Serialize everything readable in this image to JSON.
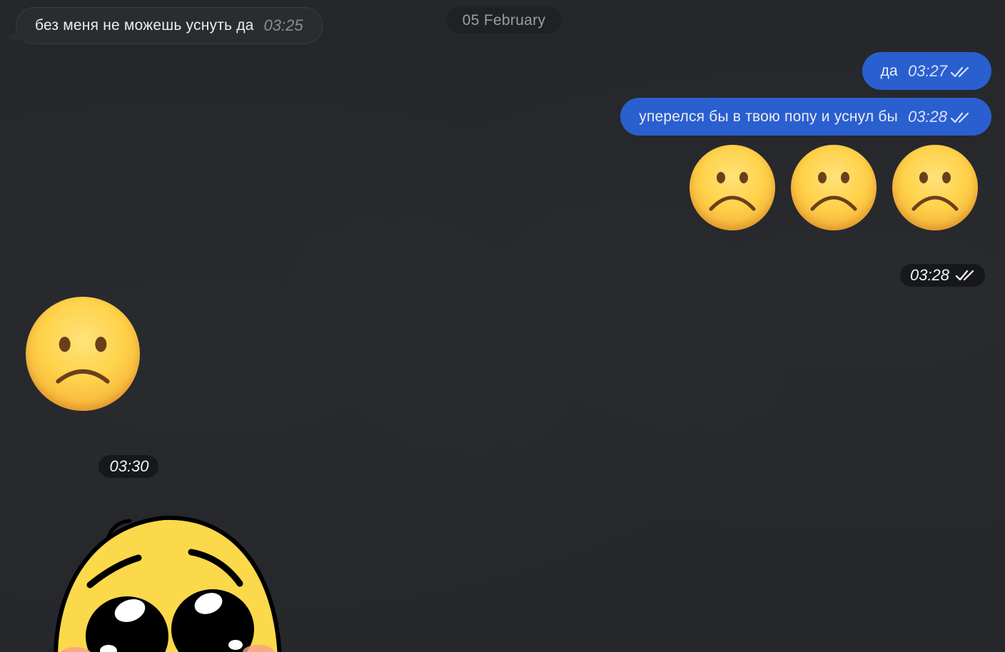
{
  "date_separator": "05 February",
  "incoming_message": {
    "text": "без меня не можешь уснуть да",
    "time": "03:25"
  },
  "outgoing_messages": [
    {
      "text": "да",
      "time": "03:27",
      "status": "read"
    },
    {
      "text": "уперелся бы в твою попу и уснул бы",
      "time": "03:28",
      "status": "read"
    }
  ],
  "outgoing_emoji_message": {
    "emoji": [
      "frowning-face",
      "frowning-face",
      "frowning-face"
    ],
    "time": "03:28",
    "status": "read"
  },
  "incoming_emoji_message": {
    "emoji": [
      "frowning-face"
    ],
    "time": "03:30"
  },
  "incoming_sticker": {
    "sticker": "pleading-face-sticker"
  },
  "colors": {
    "background": "#25272b",
    "incoming_bubble": "#2a2c30",
    "outgoing_bubble": "#2a5fd0"
  }
}
